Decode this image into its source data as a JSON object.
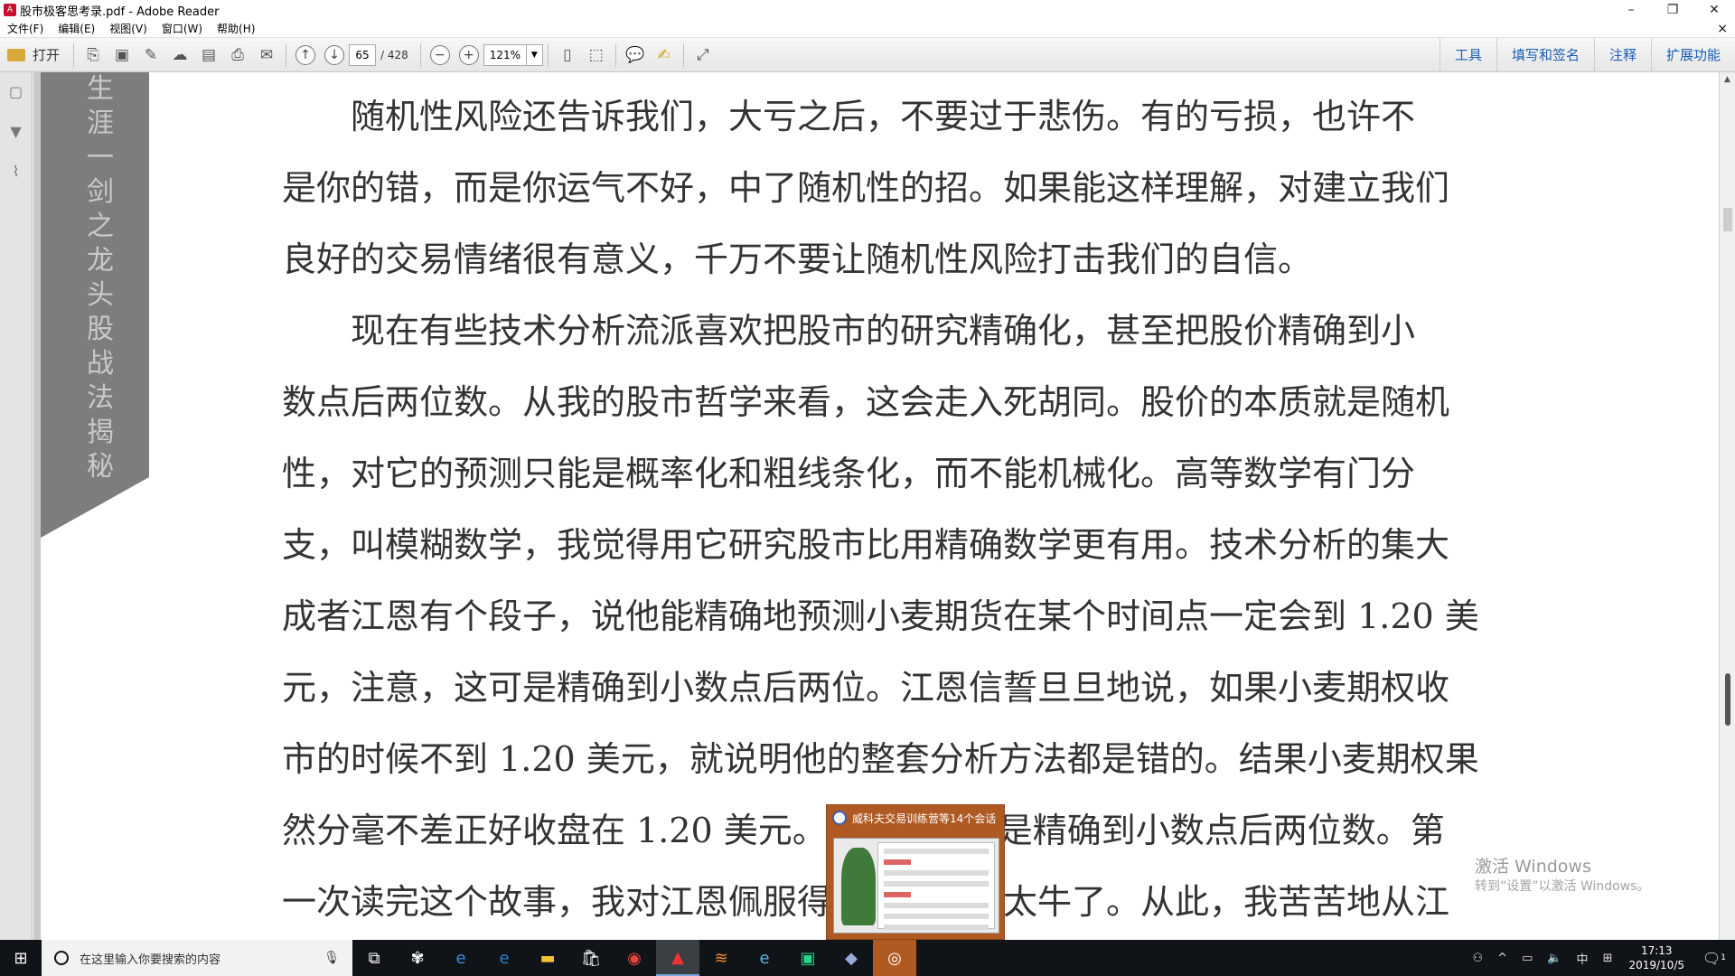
{
  "window": {
    "title": "股市极客思考录.pdf - Adobe Reader",
    "minimize": "–",
    "restore": "❐",
    "close": "✕"
  },
  "menubar": {
    "items": [
      "文件(F)",
      "编辑(E)",
      "视图(V)",
      "窗口(W)",
      "帮助(H)"
    ],
    "doc_close": "×"
  },
  "toolbar": {
    "open_label": "打开",
    "current_page": "65",
    "total_pages": "/ 428",
    "zoom": "121%",
    "right_tools": [
      "工具",
      "填写和签名",
      "注释",
      "扩展功能"
    ]
  },
  "sidebar_title": [
    "生",
    "涯",
    "一",
    "剑",
    "之",
    "龙",
    "头",
    "股",
    "战",
    "法",
    "揭",
    "秘"
  ],
  "document": {
    "lines": [
      "　　随机性风险还告诉我们，大亏之后，不要过于悲伤。有的亏损，也许不",
      "是你的错，而是你运气不好，中了随机性的招。如果能这样理解，对建立我们",
      "良好的交易情绪很有意义，千万不要让随机性风险打击我们的自信。",
      "　　现在有些技术分析流派喜欢把股市的研究精确化，甚至把股价精确到小",
      "数点后两位数。从我的股市哲学来看，这会走入死胡同。股价的本质就是随机",
      "性，对它的预测只能是概率化和粗线条化，而不能机械化。高等数学有门分",
      "支，叫模糊数学，我觉得用它研究股市比用精确数学更有用。技术分析的集大",
      "成者江恩有个段子，说他能精确地预测小麦期货在某个时间点一定会到 1.20 美",
      "元，注意，这可是精确到小数点后两位。江恩信誓旦旦地说，如果小麦期权收",
      "市的时候不到 1.20 美元，就说明他的整套分析方法都是错的。结果小麦期权果",
      "然分毫不差正好收盘在 1.20 美元。这个结果也是精确到小数点后两位数。第",
      "一次读完这个故事，我对江恩佩服得五体投地，太牛了。从此，我苦苦地从江"
    ]
  },
  "watermark": {
    "line1": "激活 Windows",
    "line2": "转到“设置”以激活 Windows。"
  },
  "thumbnail_popup": {
    "title": "威科夫交易训练营等14个会话"
  },
  "taskbar": {
    "search_placeholder": "在这里输入你要搜索的内容",
    "time": "17:13",
    "date": "2019/10/5",
    "ime": "中",
    "notification_count": "1"
  }
}
